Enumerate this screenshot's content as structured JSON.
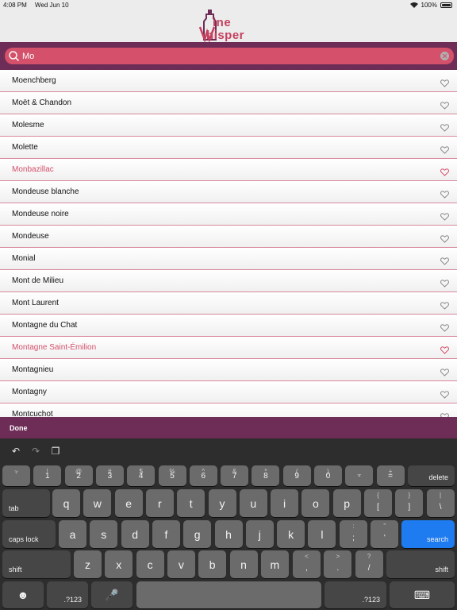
{
  "status_bar": {
    "time": "4:08 PM",
    "date": "Wed Jun 10",
    "battery": "100%"
  },
  "brand": {
    "line1": "ine",
    "line2": "hisper"
  },
  "search": {
    "value": "Mo"
  },
  "wines": [
    {
      "name": "Moenchberg",
      "favorite": false
    },
    {
      "name": "Moët & Chandon",
      "favorite": false
    },
    {
      "name": "Molesme",
      "favorite": false
    },
    {
      "name": "Molette",
      "favorite": false
    },
    {
      "name": "Monbazillac",
      "favorite": true
    },
    {
      "name": "Mondeuse blanche",
      "favorite": false
    },
    {
      "name": "Mondeuse noire",
      "favorite": false
    },
    {
      "name": "Mondeuse",
      "favorite": false
    },
    {
      "name": "Monial",
      "favorite": false
    },
    {
      "name": "Mont de Milieu",
      "favorite": false
    },
    {
      "name": "Mont Laurent",
      "favorite": false
    },
    {
      "name": "Montagne du Chat",
      "favorite": false
    },
    {
      "name": "Montagne Saint-Émilion",
      "favorite": true
    },
    {
      "name": "Montagnieu",
      "favorite": false
    },
    {
      "name": "Montagny",
      "favorite": false
    },
    {
      "name": "Montcuchot",
      "favorite": false
    }
  ],
  "colors": {
    "accent": "#d4506b",
    "band": "#6d2d57",
    "favorite_text": "#d4506b"
  },
  "toolbar": {
    "done_label": "Done"
  },
  "keyboard": {
    "number_row": [
      {
        "main": "`",
        "sub": "~"
      },
      {
        "main": "1",
        "sub": "!"
      },
      {
        "main": "2",
        "sub": "@"
      },
      {
        "main": "3",
        "sub": "#"
      },
      {
        "main": "4",
        "sub": "$"
      },
      {
        "main": "5",
        "sub": "%"
      },
      {
        "main": "6",
        "sub": "^"
      },
      {
        "main": "7",
        "sub": "&"
      },
      {
        "main": "8",
        "sub": "*"
      },
      {
        "main": "9",
        "sub": "("
      },
      {
        "main": "0",
        "sub": ")"
      },
      {
        "main": "-",
        "sub": "_"
      },
      {
        "main": "=",
        "sub": "+"
      }
    ],
    "delete_label": "delete",
    "tab_label": "tab",
    "q_row": [
      "q",
      "w",
      "e",
      "r",
      "t",
      "y",
      "u",
      "i",
      "o",
      "p"
    ],
    "q_row_symbols": [
      {
        "main": "[",
        "sub": "{"
      },
      {
        "main": "]",
        "sub": "}"
      },
      {
        "main": "\\",
        "sub": "|"
      }
    ],
    "caps_label": "caps lock",
    "a_row": [
      "a",
      "s",
      "d",
      "f",
      "g",
      "h",
      "j",
      "k",
      "l"
    ],
    "a_row_symbols": [
      {
        "main": ";",
        "sub": ":"
      },
      {
        "main": "'",
        "sub": "\""
      }
    ],
    "search_label": "search",
    "shift_label": "shift",
    "z_row": [
      "z",
      "x",
      "c",
      "v",
      "b",
      "n",
      "m"
    ],
    "z_row_symbols": [
      {
        "main": ",",
        "sub": "<"
      },
      {
        "main": ".",
        "sub": ">"
      },
      {
        "main": "/",
        "sub": "?"
      }
    ],
    "numbers_label": ".?123",
    "emoji_glyph": "☻",
    "mic_glyph": "🎤",
    "hide_glyph": "⌨",
    "undo_glyph": "↶",
    "redo_glyph": "↷",
    "paste_glyph": "❐"
  }
}
